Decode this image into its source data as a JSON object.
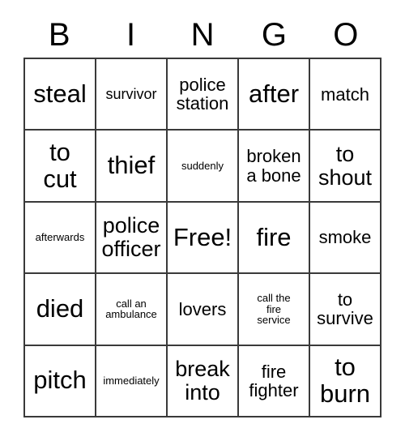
{
  "card": {
    "title": "BINGO",
    "header": [
      "B",
      "I",
      "N",
      "G",
      "O"
    ],
    "free_space_label": "Free!",
    "rows": [
      [
        {
          "text": "steal",
          "size": "xl"
        },
        {
          "text": "survivor",
          "size": "sm"
        },
        {
          "text": "police\nstation",
          "size": "md"
        },
        {
          "text": "after",
          "size": "xl"
        },
        {
          "text": "match",
          "size": "md"
        }
      ],
      [
        {
          "text": "to\ncut",
          "size": "xl"
        },
        {
          "text": "thief",
          "size": "xl"
        },
        {
          "text": "suddenly",
          "size": "xs"
        },
        {
          "text": "broken\na bone",
          "size": "md"
        },
        {
          "text": "to\nshout",
          "size": "lg"
        }
      ],
      [
        {
          "text": "afterwards",
          "size": "xs"
        },
        {
          "text": "police\nofficer",
          "size": "lg"
        },
        {
          "text": "Free!",
          "size": "xl"
        },
        {
          "text": "fire",
          "size": "xl"
        },
        {
          "text": "smoke",
          "size": "md"
        }
      ],
      [
        {
          "text": "died",
          "size": "xl"
        },
        {
          "text": "call an\nambulance",
          "size": "xs"
        },
        {
          "text": "lovers",
          "size": "md"
        },
        {
          "text": "call the\nfire\nservice",
          "size": "xs"
        },
        {
          "text": "to\nsurvive",
          "size": "md"
        }
      ],
      [
        {
          "text": "pitch",
          "size": "xl"
        },
        {
          "text": "immediately",
          "size": "xs"
        },
        {
          "text": "break\ninto",
          "size": "lg"
        },
        {
          "text": "fire\nfighter",
          "size": "md"
        },
        {
          "text": "to\nburn",
          "size": "xl"
        }
      ]
    ]
  },
  "colors": {
    "background": "#ffffff",
    "border": "#3a3a3a",
    "text": "#000000"
  }
}
